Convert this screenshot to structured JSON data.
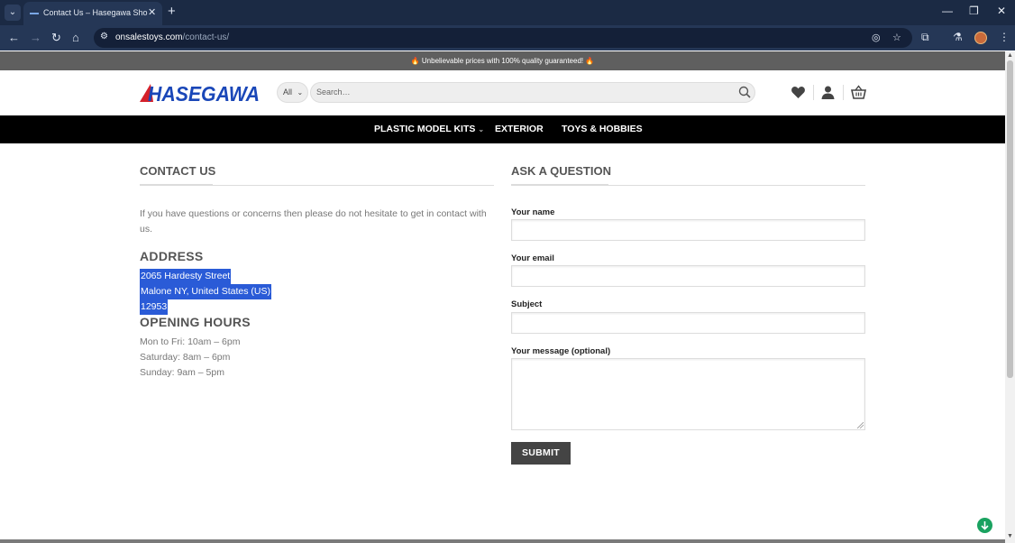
{
  "browser": {
    "tab_title": "Contact Us – Hasegawa Shop –",
    "url_host": "onsalestoys.com",
    "url_path": "/contact-us/"
  },
  "promo": {
    "text": "🔥 Unbelievable prices with 100% quality guaranteed! 🔥"
  },
  "header": {
    "logo_text": "HASEGAWA",
    "category_select": "All",
    "search_placeholder": "Search…"
  },
  "nav": {
    "items": [
      {
        "label": "PLASTIC MODEL KITS"
      },
      {
        "label": "EXTERIOR"
      },
      {
        "label": "TOYS & HOBBIES"
      }
    ]
  },
  "contact": {
    "title": "CONTACT US",
    "intro_line1": "If you have questions or concerns then please do not hesitate to get in contact with",
    "intro_line2": "us.",
    "address_heading": "ADDRESS",
    "address_line1": "2065 Hardesty Street",
    "address_line2": "Malone NY, United States (US)",
    "address_line3": "12953",
    "hours_heading": "OPENING HOURS",
    "hours": [
      "Mon to Fri: 10am – 6pm",
      "Saturday: 8am – 6pm",
      "Sunday: 9am – 5pm"
    ]
  },
  "form": {
    "title": "ASK A QUESTION",
    "name_label": "Your name",
    "email_label": "Your email",
    "subject_label": "Subject",
    "message_label": "Your message (optional)",
    "submit_label": "SUBMIT"
  },
  "colors": {
    "browser_frame": "#1b2a44",
    "promo_bar": "#5f5f5f",
    "nav_bar": "#000000",
    "logo_blue": "#1a47b8",
    "logo_red": "#d4202a",
    "selection": "#2a5bd7",
    "submit_button": "#444444"
  }
}
